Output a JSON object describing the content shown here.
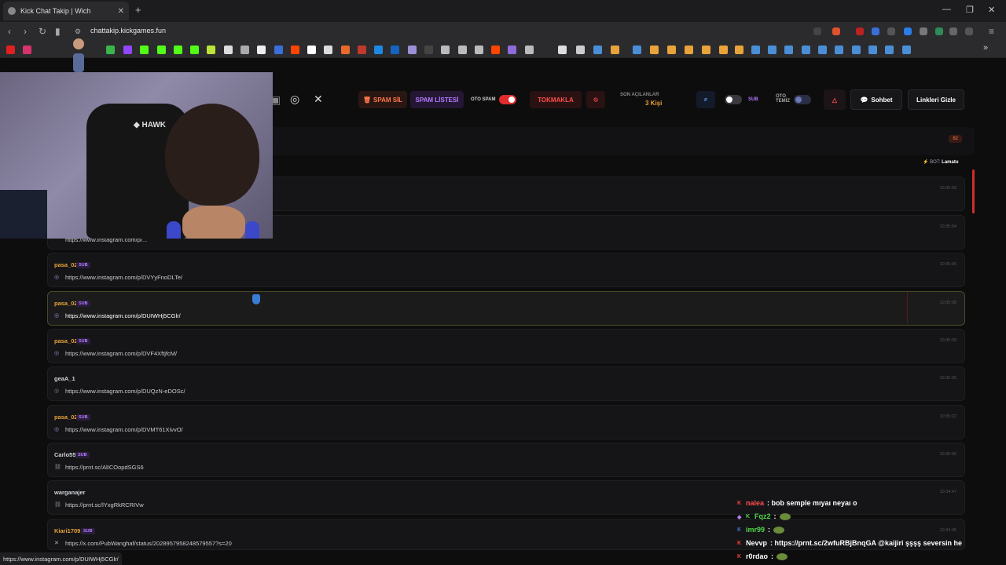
{
  "browser": {
    "tab_title": "Kick Chat Takip | Wich",
    "url": "chattakip.kickgames.fun",
    "status_url": "https://www.instagram.com/p/DUIWHj5CGlr/"
  },
  "toolbar": {
    "spam_sil": "SPAM SİL",
    "spam_listesi": "SPAM LİSTESİ",
    "oto_spam": "OTO SPAM",
    "tokmakla": "TOKMAKLA",
    "son_acilanlar_label": "SON AÇILANLAR",
    "son_acilanlar_value": "3 Kişi",
    "sub_label": "SUB",
    "oto_temiz_label": "OTO TEMİZ",
    "sohbet": "Sohbet",
    "linkleri_gizle": "Linkleri Gizle",
    "oto_spam_on": true,
    "sub_on": false,
    "oto_temiz_on": false
  },
  "panel": {
    "count_badge": "82",
    "bot_label": "BOT:",
    "bot_name": "Lamatu"
  },
  "messages": [
    {
      "user": "pasa_02",
      "sub": true,
      "link": "https://www.instagram.com/p/DVYyFnoDLTe/",
      "time": "10:35:45",
      "kind": "ig"
    },
    {
      "user": "pasa_02",
      "sub": true,
      "link": "https://www.instagram.com/p/DUIWHj5CGlr/",
      "time": "10:35:38",
      "kind": "ig",
      "highlight": true
    },
    {
      "user": "pasa_02",
      "sub": true,
      "link": "https://www.instagram.com/p/DVF4XftjfcM/",
      "time": "10:35:28",
      "kind": "ig"
    },
    {
      "user": "geaA_1",
      "sub": false,
      "link": "https://www.instagram.com/p/DUQzN-eDOSc/",
      "time": "10:35:25",
      "kind": "ig"
    },
    {
      "user": "pasa_02",
      "sub": true,
      "link": "https://www.instagram.com/p/DVMT61XivvO/",
      "time": "10:35:22",
      "kind": "ig"
    },
    {
      "user": "Carlo55",
      "sub": true,
      "link": "https://prnt.sc/AlICOopdSGS6",
      "time": "10:35:06",
      "kind": "link"
    },
    {
      "user": "warganajer",
      "sub": false,
      "link": "https://prnt.sc/lYxgRkRCRIVw",
      "time": "10:34:47",
      "kind": "link"
    },
    {
      "user": "Kiari1709",
      "sub": true,
      "link": "https://x.com/PubWanghaf/status/2028957958248579557?s=20",
      "time": "10:34:45",
      "kind": "x"
    }
  ],
  "partial_rows": [
    {
      "time": "10:35:59"
    },
    {
      "time": "10:35:54",
      "link": "https://www.instagram.com/p/..."
    }
  ],
  "sub_badge": "SUB",
  "chat_overlay": [
    {
      "user": "nalea",
      "text": ": bob semple mıyaı neyaı o",
      "color": "#ff4d4d"
    },
    {
      "user": "Fqz2",
      "text": ":",
      "color": "#52d64c",
      "emote": true
    },
    {
      "user": "imr99",
      "text": ":",
      "color": "#52d64c",
      "emote": true
    },
    {
      "user": "Nevvp",
      "text": ": https://prnt.sc/2wfuRBjBnqGA @kaijiri şşşş seversin he",
      "color": "#ffffff"
    },
    {
      "user": "r0rdao",
      "text": ":",
      "color": "#ffffff",
      "emote": true
    }
  ],
  "colors": {
    "accent_orange": "#e8a33a",
    "danger_red": "#d12d2d",
    "sub_purple": "#b67cff"
  }
}
